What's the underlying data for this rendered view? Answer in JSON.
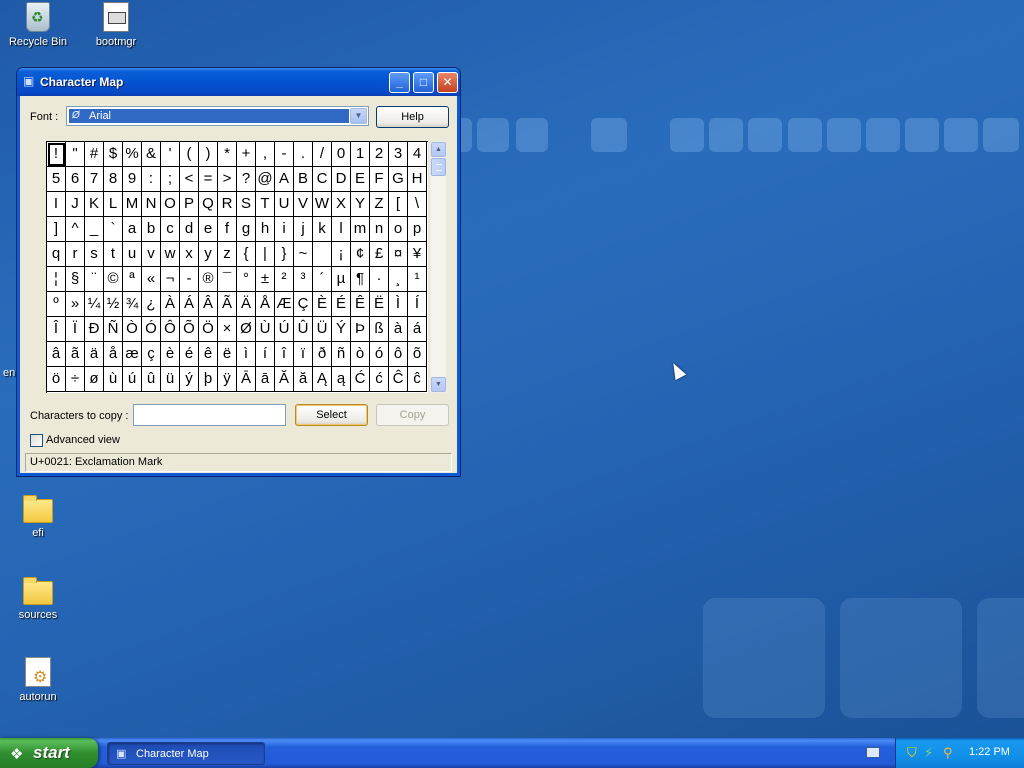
{
  "desktop": {
    "icons": [
      {
        "label": "Recycle Bin",
        "icon": "recycle-bin-icon"
      },
      {
        "label": "bootmgr",
        "icon": "system-file-icon"
      },
      {
        "label": "efi",
        "icon": "folder-icon"
      },
      {
        "label": "sources",
        "icon": "folder-icon"
      },
      {
        "label": "autorun",
        "icon": "setup-info-file-icon"
      }
    ],
    "partial_label": "en"
  },
  "window": {
    "title": "Character Map",
    "font_label": "Font :",
    "font_value": "Arial",
    "font_type_glyph": "Ø",
    "help_label": "Help",
    "characters": [
      "!",
      "\"",
      "#",
      "$",
      "%",
      "&",
      "'",
      "(",
      ")",
      "*",
      "+",
      ",",
      "-",
      ".",
      "/",
      "0",
      "1",
      "2",
      "3",
      "4",
      "5",
      "6",
      "7",
      "8",
      "9",
      ":",
      ";",
      "<",
      "=",
      ">",
      "?",
      "@",
      "A",
      "B",
      "C",
      "D",
      "E",
      "F",
      "G",
      "H",
      "I",
      "J",
      "K",
      "L",
      "M",
      "N",
      "O",
      "P",
      "Q",
      "R",
      "S",
      "T",
      "U",
      "V",
      "W",
      "X",
      "Y",
      "Z",
      "[",
      "\\",
      "]",
      "^",
      "_",
      "`",
      "a",
      "b",
      "c",
      "d",
      "e",
      "f",
      "g",
      "h",
      "i",
      "j",
      "k",
      "l",
      "m",
      "n",
      "o",
      "p",
      "q",
      "r",
      "s",
      "t",
      "u",
      "v",
      "w",
      "x",
      "y",
      "z",
      "{",
      "|",
      "}",
      "~",
      " ",
      "¡",
      "¢",
      "£",
      "¤",
      "¥",
      "¦",
      "§",
      "¨",
      "©",
      "ª",
      "«",
      "¬",
      "-",
      "®",
      "¯",
      "°",
      "±",
      "²",
      "³",
      "´",
      "µ",
      "¶",
      "·",
      "¸",
      "¹",
      "º",
      "»",
      "¼",
      "½",
      "¾",
      "¿",
      "À",
      "Á",
      "Â",
      "Ã",
      "Ä",
      "Å",
      "Æ",
      "Ç",
      "È",
      "É",
      "Ê",
      "Ë",
      "Ì",
      "Í",
      "Î",
      "Ï",
      "Ð",
      "Ñ",
      "Ò",
      "Ó",
      "Ô",
      "Õ",
      "Ö",
      "×",
      "Ø",
      "Ù",
      "Ú",
      "Û",
      "Ü",
      "Ý",
      "Þ",
      "ß",
      "à",
      "á",
      "â",
      "ã",
      "ä",
      "å",
      "æ",
      "ç",
      "è",
      "é",
      "ê",
      "ë",
      "ì",
      "í",
      "î",
      "ï",
      "ð",
      "ñ",
      "ò",
      "ó",
      "ô",
      "õ",
      "ö",
      "÷",
      "ø",
      "ù",
      "ú",
      "û",
      "ü",
      "ý",
      "þ",
      "ÿ",
      "Ā",
      "ā",
      "Ă",
      "ă",
      "Ą",
      "ą",
      "Ć",
      "ć",
      "Ĉ",
      "ĉ"
    ],
    "selected_index": 0,
    "chars_to_copy_label": "Characters to copy :",
    "chars_to_copy_value": "",
    "select_label": "Select",
    "copy_label": "Copy",
    "advanced_view_label": "Advanced view",
    "advanced_view_checked": false,
    "status_text": "U+0021: Exclamation Mark"
  },
  "taskbar": {
    "start_label": "start",
    "tasks": [
      {
        "label": "Character Map",
        "icon": "character-map-icon"
      }
    ],
    "tray_icons": [
      "keyboard-icon",
      "security-shield-icon",
      "network-icon",
      "search-icon"
    ],
    "clock": "1:22 PM"
  },
  "colors": {
    "desktop": "#2a6dbd",
    "titlebar": "#0453d0",
    "window_face": "#ece9d8",
    "start_button": "#2f8f2f",
    "selection": "#316ac5"
  }
}
